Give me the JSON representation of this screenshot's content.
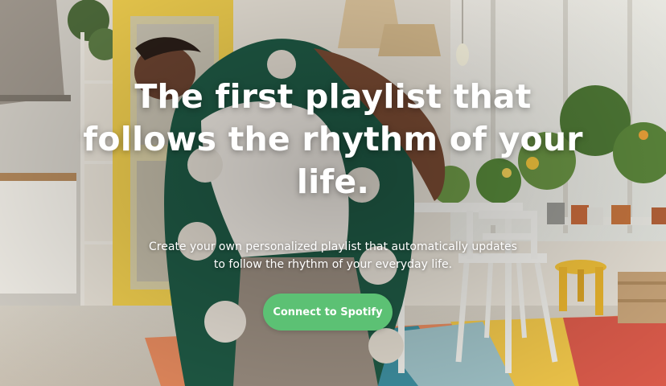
{
  "hero": {
    "headline": "The first playlist that follows the rhythm of your life.",
    "subtext": "Create your own personalized playlist that automatically updates to follow the rhythm of your everyday life.",
    "cta_label": "Connect to Spotify"
  },
  "colors": {
    "cta_background": "#5cc174",
    "text": "#ffffff"
  }
}
